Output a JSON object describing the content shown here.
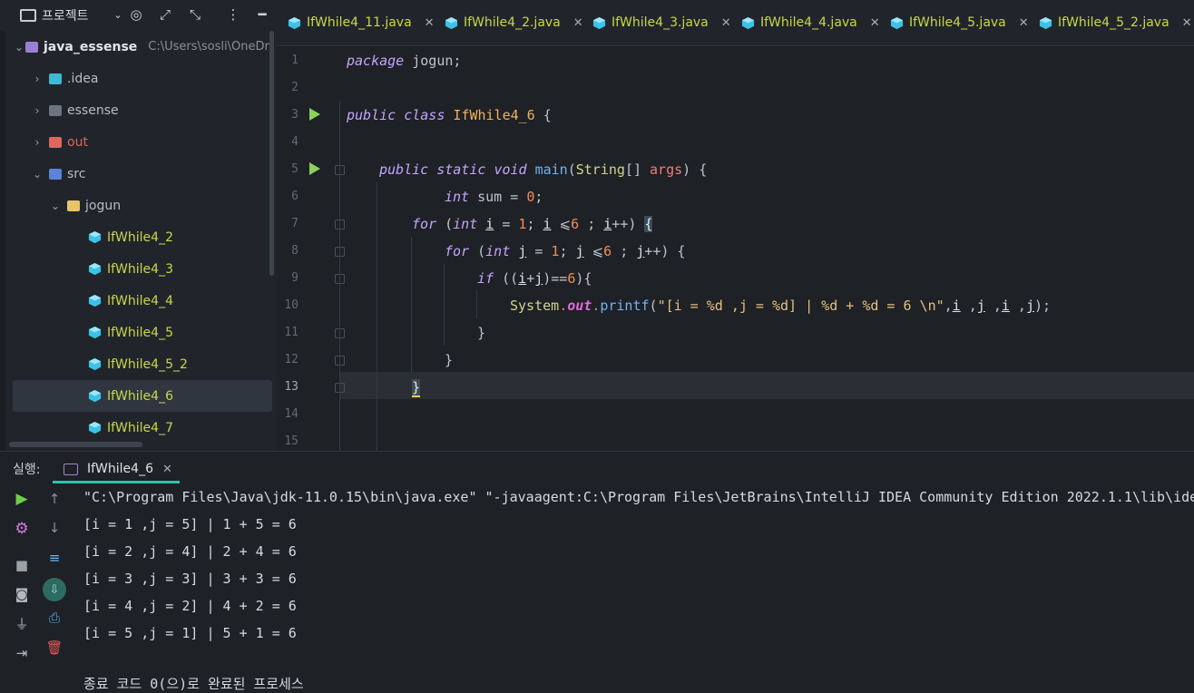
{
  "project_panel": {
    "title": "프로젝트",
    "root": {
      "name": "java_essense",
      "path": "C:\\Users\\sosli\\OneDr"
    },
    "items": [
      {
        "label": ".idea"
      },
      {
        "label": "essense"
      },
      {
        "label": "out"
      },
      {
        "label": "src"
      },
      {
        "label": "jogun"
      },
      {
        "label": "IfWhile4_2"
      },
      {
        "label": "IfWhile4_3"
      },
      {
        "label": "IfWhile4_4"
      },
      {
        "label": "IfWhile4_5"
      },
      {
        "label": "IfWhile4_5_2"
      },
      {
        "label": "IfWhile4_6"
      },
      {
        "label": "IfWhile4_7"
      }
    ]
  },
  "tabs": [
    {
      "label": "IfWhile4_11.java"
    },
    {
      "label": "IfWhile4_2.java"
    },
    {
      "label": "IfWhile4_3.java"
    },
    {
      "label": "IfWhile4_4.java"
    },
    {
      "label": "IfWhile4_5.java"
    },
    {
      "label": "IfWhile4_5_2.java"
    }
  ],
  "editor": {
    "line_numbers": [
      "1",
      "2",
      "3",
      "4",
      "5",
      "6",
      "7",
      "8",
      "9",
      "10",
      "11",
      "12",
      "13",
      "14",
      "15"
    ],
    "code": {
      "l1_kw": "package",
      "l1_rest": " jogun;",
      "l3_kw1": "public",
      "l3_kw2": "class",
      "l3_cls": "IfWhile4_6",
      "l3_rest": " {",
      "l5_kw1": "public",
      "l5_kw2": "static",
      "l5_kw3": "void",
      "l5_fn": "main",
      "l5_p1": "(",
      "l5_type": "String",
      "l5_p2": "[] ",
      "l5_arg": "args",
      "l5_p3": ") {",
      "l6_kw": "int",
      "l6_rest": " sum = ",
      "l6_num": "0",
      "l6_end": ";",
      "l7_for": "for",
      "l7_a": " (",
      "l7_int": "int",
      "l7_b": " ",
      "l7_i1": "i",
      "l7_c": " = ",
      "l7_n1": "1",
      "l7_d": "; ",
      "l7_i2": "i",
      "l7_e": " ⩽",
      "l7_n2": "6",
      "l7_f": " ; ",
      "l7_i3": "i",
      "l7_g": "++) ",
      "l7_brace": "{",
      "l8_for": "for",
      "l8_a": " (",
      "l8_int": "int",
      "l8_b": " ",
      "l8_j1": "j",
      "l8_c": " = ",
      "l8_n1": "1",
      "l8_d": "; ",
      "l8_j2": "j",
      "l8_e": " ⩽",
      "l8_n2": "6",
      "l8_f": " ; ",
      "l8_j3": "j",
      "l8_g": "++) {",
      "l9_if": "if",
      "l9_a": " ((",
      "l9_i": "i",
      "l9_plus": "+",
      "l9_j": "j",
      "l9_b": ")==",
      "l9_n": "6",
      "l9_c": "){",
      "l10_sys": "System",
      "l10_dot1": ".",
      "l10_out": "out",
      "l10_dot2": ".",
      "l10_fn": "printf",
      "l10_p": "(",
      "l10_str": "\"[i = %d ,j = %d] | %d + %d = 6 \\n\"",
      "l10_c1": ",",
      "l10_v1": "i",
      "l10_c2": " ,",
      "l10_v2": "j",
      "l10_c3": " ,",
      "l10_v3": "i",
      "l10_c4": " ,",
      "l10_v4": "j",
      "l10_end": ");",
      "l11": "}",
      "l12": "}",
      "l13": "}"
    }
  },
  "run": {
    "label": "실행:",
    "tab": "IfWhile4_6",
    "output": [
      "\"C:\\Program Files\\Java\\jdk-11.0.15\\bin\\java.exe\" \"-javaagent:C:\\Program Files\\JetBrains\\IntelliJ IDEA Community Edition 2022.1.1\\lib\\ide",
      "[i = 1 ,j = 5] | 1 + 5 = 6",
      "[i = 2 ,j = 4] | 2 + 4 = 6",
      "[i = 3 ,j = 3] | 3 + 3 = 6",
      "[i = 4 ,j = 2] | 4 + 2 = 6",
      "[i = 5 ,j = 1] | 5 + 1 = 6",
      "",
      "종료 코드 0(으)로 완료된 프로세스"
    ]
  },
  "colors": {
    "accent": "#2ec4a8",
    "run_green": "#8bd15b",
    "java_file": "#c9d64a"
  }
}
